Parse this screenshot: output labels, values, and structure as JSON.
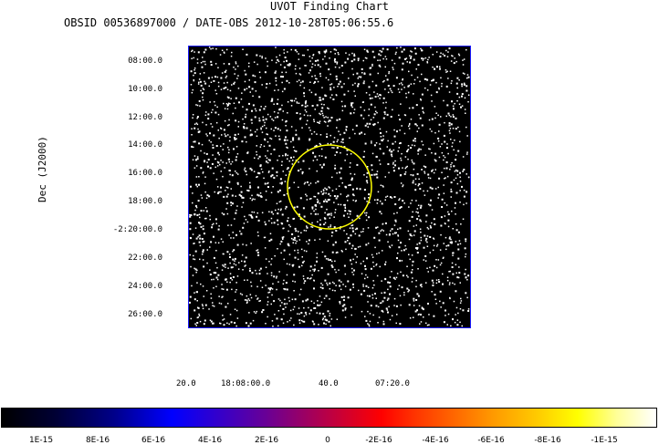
{
  "header": {
    "title": "UVOT Finding Chart",
    "subtitle": "OBSID 00536897000 / DATE-OBS 2012-10-28T05:06:55.6"
  },
  "chart_data": {
    "type": "scatter",
    "title": "UVOT Finding Chart",
    "ylabel": "Dec (J2000)",
    "xlabel": "",
    "y_ticks": [
      "08:00.0",
      "10:00.0",
      "12:00.0",
      "14:00.0",
      "16:00.0",
      "18:00.0",
      "-2:20:00.0",
      "22:00.0",
      "24:00.0",
      "26:00.0"
    ],
    "x_ticks": [
      "20.0",
      "18:08:00.0",
      "40.0",
      "07:20.0"
    ],
    "circle_marker": {
      "color": "#ffff00",
      "center_ra": "18:07:40.0",
      "center_dec": "-2:17:00.0"
    },
    "colors": {
      "background": "#000000",
      "stars": "#ffffff",
      "frame": "#1a1aff",
      "marker": "#ffff00"
    }
  },
  "colorbar": {
    "labels": [
      "1E-15",
      "8E-16",
      "6E-16",
      "4E-16",
      "2E-16",
      "0",
      "-2E-16",
      "-4E-16",
      "-6E-16",
      "-8E-16",
      "-1E-15"
    ]
  }
}
